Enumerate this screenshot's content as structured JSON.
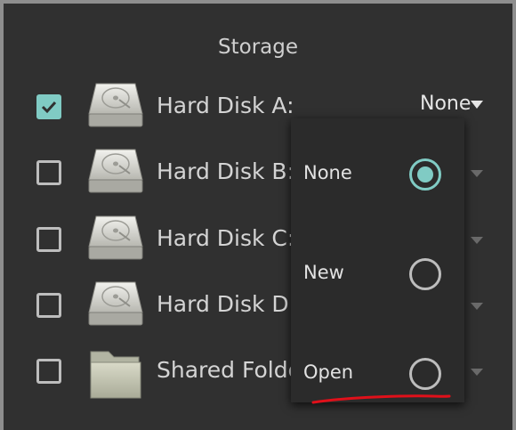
{
  "storage": {
    "title": "Storage",
    "rows": [
      {
        "label": "Hard Disk A:",
        "checked": true,
        "icon": "hard-disk-icon",
        "value": "None"
      },
      {
        "label": "Hard Disk B:",
        "checked": false,
        "icon": "hard-disk-icon"
      },
      {
        "label": "Hard Disk C:",
        "checked": false,
        "icon": "hard-disk-icon"
      },
      {
        "label": "Hard Disk D:",
        "checked": false,
        "icon": "hard-disk-icon"
      },
      {
        "label": "Shared Folder",
        "checked": false,
        "icon": "folder-icon"
      }
    ]
  },
  "menu": {
    "options": [
      {
        "label": "None",
        "selected": true
      },
      {
        "label": "New",
        "selected": false
      },
      {
        "label": "Open",
        "selected": false
      }
    ],
    "annotation_color": "#e0101a"
  },
  "colors": {
    "accent": "#80cbc4",
    "background": "#303030"
  }
}
